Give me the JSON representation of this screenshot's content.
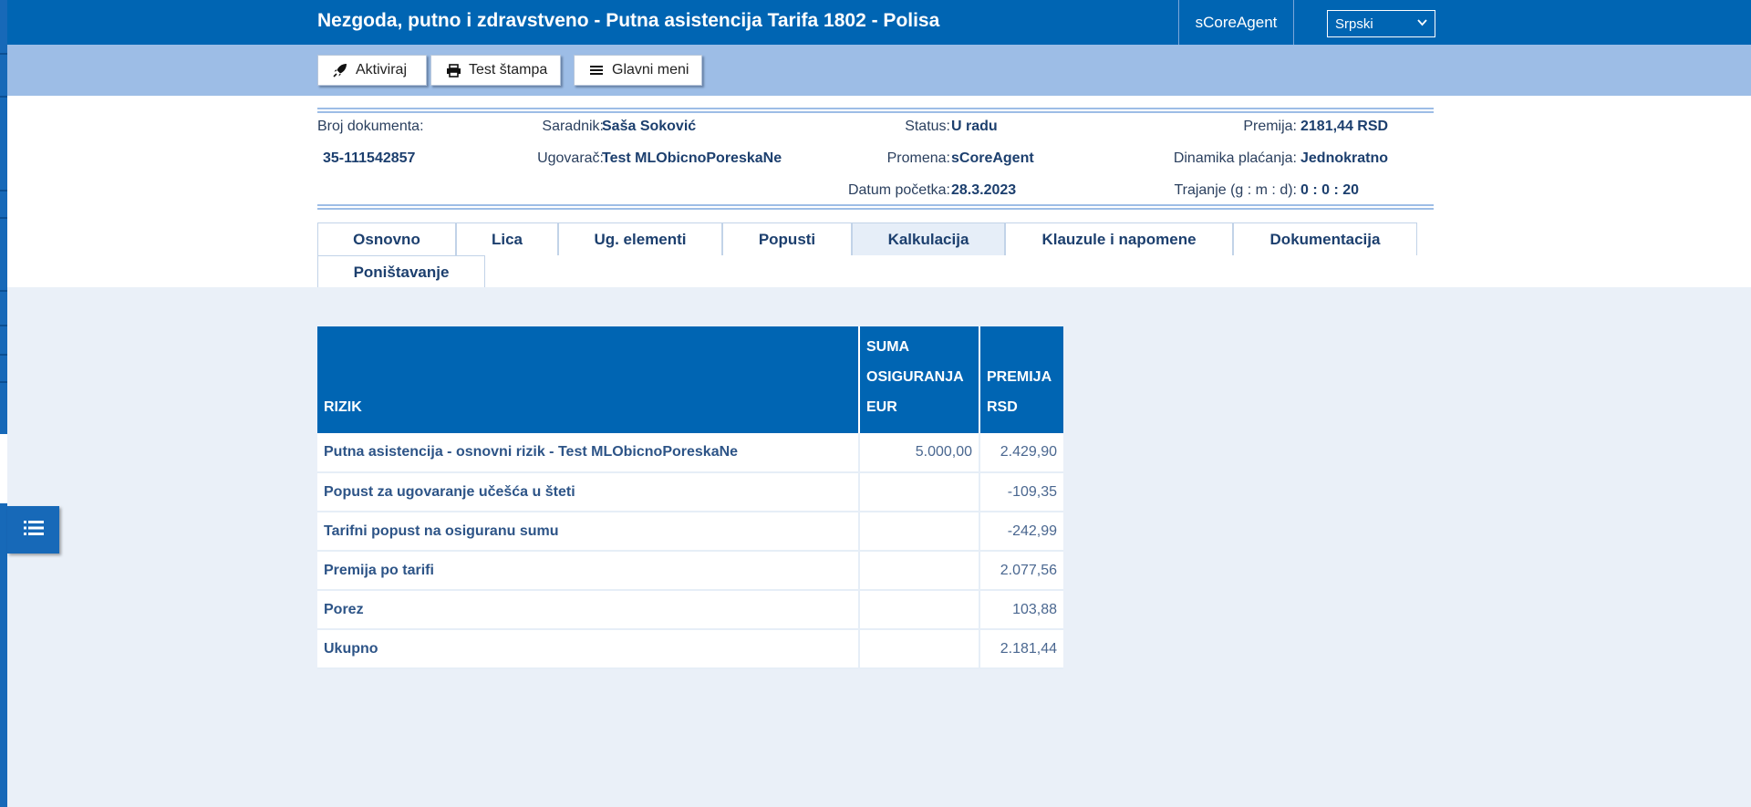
{
  "header": {
    "title": "Nezgoda, putno i zdravstveno - Putna asistencija Tarifa 1802 - Polisa",
    "agent": "sCoreAgent",
    "language": "Srpski"
  },
  "toolbar": {
    "activate_label": "Aktiviraj",
    "print_label": "Test štampa",
    "menu_label": "Glavni meni"
  },
  "info": {
    "doc_label": "Broj dokumenta:",
    "doc_value": "35-111542857",
    "saradnik_label": "Saradnik:",
    "saradnik_value": "Saša Soković",
    "ugovarac_label": "Ugovarač:",
    "ugovarac_value": "Test MLObicnoPoreskaNe",
    "status_label": "Status:",
    "status_value": "U radu",
    "promena_label": "Promena:",
    "promena_value": "sCoreAgent",
    "datum_label": "Datum početka:",
    "datum_value": "28.3.2023",
    "premija_label": "Premija:",
    "premija_value": "2181,44 RSD",
    "dinamika_label": "Dinamika plaćanja:",
    "dinamika_value": "Jednokratno",
    "trajanje_label": "Trajanje (g : m : d):",
    "trajanje_value": "0 : 0 : 20"
  },
  "tabs": [
    "Osnovno",
    "Lica",
    "Ug. elementi",
    "Popusti",
    "Kalkulacija",
    "Klauzule i napomene",
    "Dokumentacija",
    "Poništavanje"
  ],
  "active_tab": "Kalkulacija",
  "table": {
    "headers": {
      "rizik": "RIZIK",
      "suma_1": "SUMA",
      "suma_2": "OSIGURANJA",
      "suma_3": "EUR",
      "premija_1": "PREMIJA",
      "premija_2": "RSD"
    },
    "rows": [
      {
        "rizik": "Putna asistencija - osnovni rizik - Test MLObicnoPoreskaNe",
        "suma": "5.000,00",
        "premija": "2.429,90"
      },
      {
        "rizik": "Popust za ugovaranje učešća u šteti",
        "suma": "",
        "premija": "-109,35"
      },
      {
        "rizik": "Tarifni popust na osiguranu sumu",
        "suma": "",
        "premija": "-242,99"
      },
      {
        "rizik": "Premija po tarifi",
        "suma": "",
        "premija": "2.077,56"
      },
      {
        "rizik": "Porez",
        "suma": "",
        "premija": "103,88"
      },
      {
        "rizik": "Ukupno",
        "suma": "",
        "premija": "2.181,44"
      }
    ]
  },
  "icons": {
    "activate": "rocket-icon",
    "print": "printer-icon",
    "menu": "hamburger-icon",
    "side": "list-icon",
    "select": "chevron-down-icon"
  },
  "colors": {
    "primary": "#0065b3",
    "toolbar_bg": "#9dbde6",
    "content_bg": "#eaf0f8"
  }
}
